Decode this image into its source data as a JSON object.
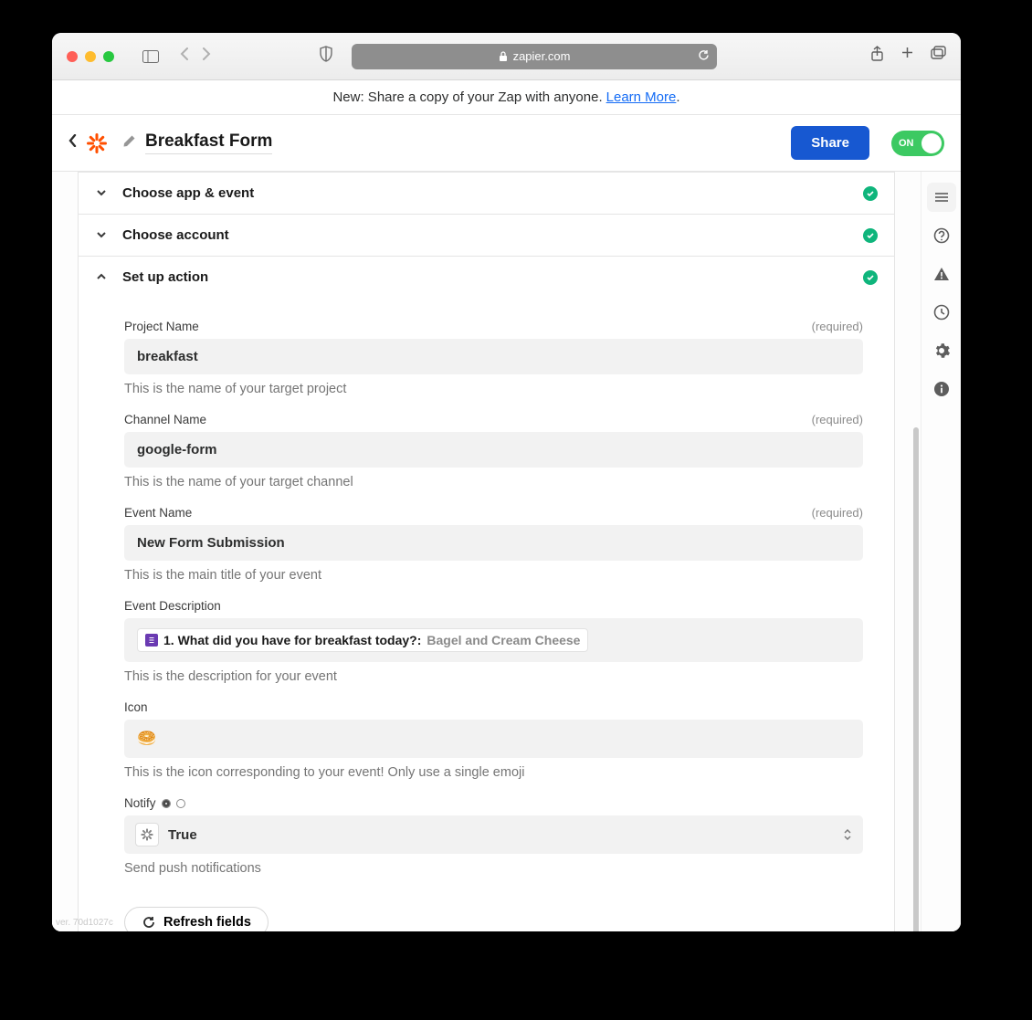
{
  "browser": {
    "url_host": "zapier.com"
  },
  "banner": {
    "text": "New: Share a copy of your Zap with anyone. ",
    "link_text": "Learn More",
    "period": "."
  },
  "header": {
    "zap_title": "Breakfast Form",
    "share_label": "Share",
    "toggle_label": "ON"
  },
  "sections": {
    "app_event": {
      "title": "Choose app & event",
      "complete": true,
      "expanded": false
    },
    "account": {
      "title": "Choose account",
      "complete": true,
      "expanded": false
    },
    "action": {
      "title": "Set up action",
      "complete": true,
      "expanded": true
    }
  },
  "form": {
    "project_name": {
      "label": "Project Name",
      "required_text": "(required)",
      "value": "breakfast",
      "helper": "This is the name of your target project"
    },
    "channel_name": {
      "label": "Channel Name",
      "required_text": "(required)",
      "value": "google-form",
      "helper": "This is the name of your target channel"
    },
    "event_name": {
      "label": "Event Name",
      "required_text": "(required)",
      "value": "New Form Submission",
      "helper": "This is the main title of your event"
    },
    "event_description": {
      "label": "Event Description",
      "pill_prefix": "1. What did you have for breakfast today?: ",
      "pill_value": "Bagel and Cream Cheese",
      "helper": "This is the description for your event"
    },
    "icon": {
      "label": "Icon",
      "value": "🥯",
      "helper": "This is the icon corresponding to your event! Only use a single emoji"
    },
    "notify": {
      "label": "Notify",
      "value": "True",
      "helper": "Send push notifications"
    },
    "refresh_label": "Refresh fields"
  },
  "version": "ver. 70d1027c"
}
